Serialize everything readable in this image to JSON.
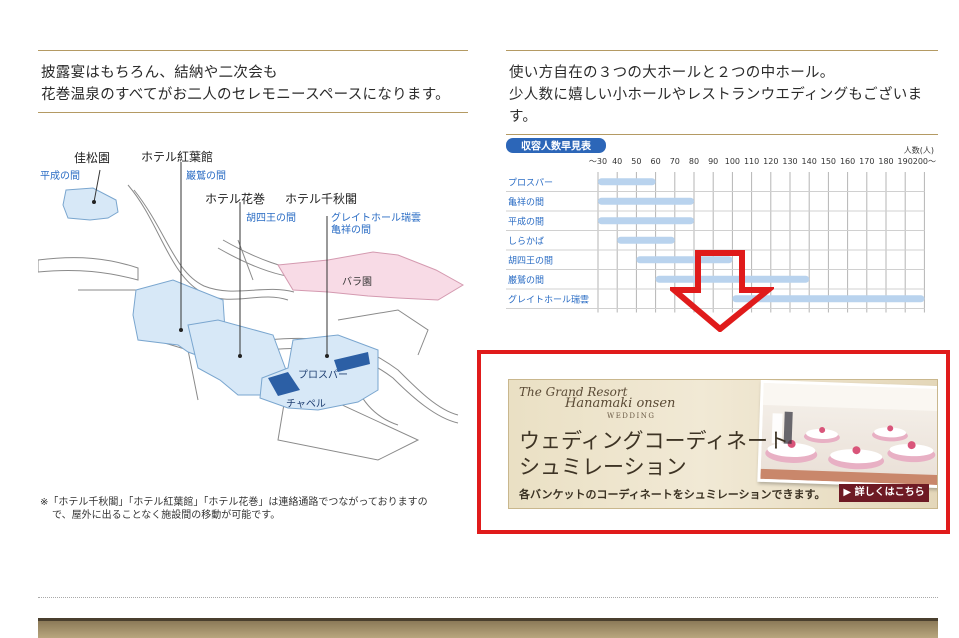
{
  "left_heading": {
    "line1": "披露宴はもちろん、結納や二次会も",
    "line2": "花巻温泉のすべてがお二人のセレモニースペースになります。"
  },
  "right_heading": {
    "line1": "使い方自在の３つの大ホールと２つの中ホール。",
    "line2": "少人数に嬉しい小ホールやレストランウエディングもございます。"
  },
  "map": {
    "kashoen": "佳松園",
    "heisei": "平成の間",
    "koyokan": "ホテル紅葉館",
    "ganju": "巌鷲の間",
    "hanamaki": "ホテル花巻",
    "senshukaku": "ホテル千秋閣",
    "koshio": "胡四王の間",
    "great_hall": "グレイトホール瑞雲",
    "kisho": "亀祥の間",
    "bara": "バラ園",
    "prospar": "プロスパー",
    "chapel": "チャペル",
    "note_line1": "※「ホテル千秋閣」「ホテル紅葉館」「ホテル花巻」は連絡通路でつながっておりますの",
    "note_line2": "で、屋外に出ることなく施設間の移動が可能です。"
  },
  "chart_data": {
    "type": "bar",
    "title": "収容人数早見表",
    "unit_label": "人数(人)",
    "ticks": [
      "〜30",
      "40",
      "50",
      "60",
      "70",
      "80",
      "90",
      "100",
      "110",
      "120",
      "130",
      "140",
      "150",
      "160",
      "170",
      "180",
      "190",
      "200〜"
    ],
    "rows": [
      {
        "name": "プロスパー",
        "min": 30,
        "max": 60
      },
      {
        "name": "亀祥の間",
        "min": 30,
        "max": 80
      },
      {
        "name": "平成の間",
        "min": 30,
        "max": 80
      },
      {
        "name": "しらかば",
        "min": 40,
        "max": 70
      },
      {
        "name": "胡四王の間",
        "min": 50,
        "max": 100
      },
      {
        "name": "巌鷲の間",
        "min": 60,
        "max": 140
      },
      {
        "name": "グレイトホール瑞雲",
        "min": 100,
        "max": 200
      }
    ],
    "bar_color": "#b9d3ee",
    "label_color": "#2a6cc4"
  },
  "banner": {
    "brand_line1": "The Grand Resort",
    "brand_line2": "Hanamaki onsen",
    "brand_line3": "WEDDING",
    "title": "ウェディングコーディネート\nシュミレーション",
    "description": "各バンケットのコーディネートをシュミレーションできます。",
    "button_label": "▶ 詳しくはこちら"
  },
  "colors": {
    "rule": "#b49a63",
    "highlight": "#e01b1b",
    "arrow": "#e01b1b",
    "map_building": "#d7e8f7",
    "map_garden": "#f8dbe6"
  }
}
